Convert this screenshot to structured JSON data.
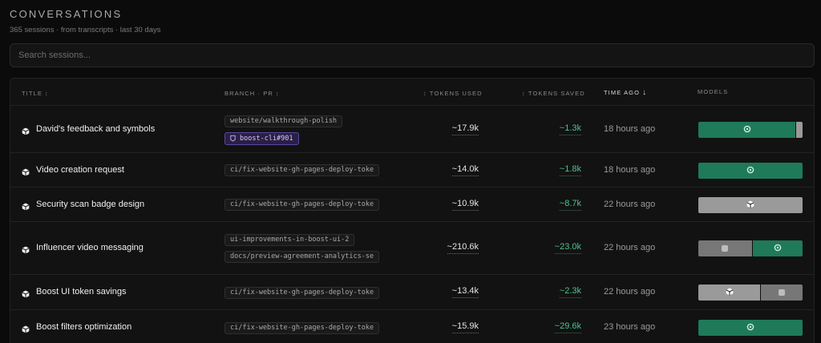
{
  "header": {
    "title": "CONVERSATIONS",
    "subtitle": "365 sessions · from transcripts · last 30 days"
  },
  "search": {
    "placeholder": "Search sessions..."
  },
  "columns": {
    "title": "TITLE",
    "branch": "BRANCH · PR",
    "tokens_used": "TOKENS USED",
    "tokens_saved": "TOKENS SAVED",
    "time_ago": "TIME AGO",
    "models": "MODELS",
    "sort_icon": "↕",
    "active_sort_icon": "↓"
  },
  "colors": {
    "accent_green": "#1f7a5a",
    "saved_green": "#4fc08d",
    "pr_purple": "#2a1f45"
  },
  "rows": [
    {
      "title": "David's feedback and symbols",
      "branches": [
        "website/walkthrough-polish"
      ],
      "pr": "boost-cli#901",
      "tokens_used": "~17.9k",
      "tokens_saved": "~1.3k",
      "ago": "18 hours ago",
      "models": [
        {
          "type": "green",
          "share": 0.94,
          "icon": "openai-icon"
        },
        {
          "type": "light",
          "share": 0.06,
          "icon": ""
        }
      ]
    },
    {
      "title": "Video creation request",
      "branches": [
        "ci/fix-website-gh-pages-deploy-toke"
      ],
      "pr": "",
      "tokens_used": "~14.0k",
      "tokens_saved": "~1.8k",
      "ago": "18 hours ago",
      "models": [
        {
          "type": "green",
          "share": 1.0,
          "icon": "openai-icon"
        }
      ]
    },
    {
      "title": "Security scan badge design",
      "branches": [
        "ci/fix-website-gh-pages-deploy-toke"
      ],
      "pr": "",
      "tokens_used": "~10.9k",
      "tokens_saved": "~8.7k",
      "ago": "22 hours ago",
      "models": [
        {
          "type": "light",
          "share": 1.0,
          "icon": "cube-icon"
        }
      ]
    },
    {
      "title": "Influencer video messaging",
      "branches": [
        "ui-improvements-in-boost-ui-2",
        "docs/preview-agreement-analytics-se"
      ],
      "pr": "",
      "tokens_used": "~210.6k",
      "tokens_saved": "~23.0k",
      "ago": "22 hours ago",
      "models": [
        {
          "type": "dark",
          "share": 0.52,
          "icon": "square-icon"
        },
        {
          "type": "green",
          "share": 0.48,
          "icon": "openai-icon"
        }
      ]
    },
    {
      "title": "Boost UI token savings",
      "branches": [
        "ci/fix-website-gh-pages-deploy-toke"
      ],
      "pr": "",
      "tokens_used": "~13.4k",
      "tokens_saved": "~2.3k",
      "ago": "22 hours ago",
      "models": [
        {
          "type": "light",
          "share": 0.6,
          "icon": "cube-icon"
        },
        {
          "type": "dark",
          "share": 0.4,
          "icon": "square-icon"
        }
      ]
    },
    {
      "title": "Boost filters optimization",
      "branches": [
        "ci/fix-website-gh-pages-deploy-toke"
      ],
      "pr": "",
      "tokens_used": "~15.9k",
      "tokens_saved": "~29.6k",
      "ago": "23 hours ago",
      "models": [
        {
          "type": "green",
          "share": 1.0,
          "icon": "openai-icon"
        }
      ]
    }
  ]
}
